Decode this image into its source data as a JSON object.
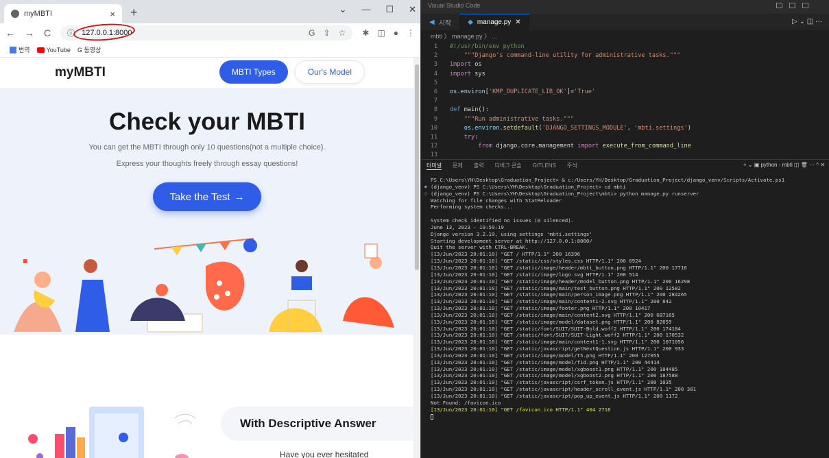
{
  "browser": {
    "tab_title": "myMBTI",
    "new_tab": "+",
    "url": "127.0.0.1:8000",
    "bookmarks": [
      "번역",
      "YouTube",
      "G 동영상"
    ],
    "window_controls": [
      "⌄",
      "—",
      "☐",
      "✕"
    ]
  },
  "site": {
    "logo": "myMBTI",
    "nav": [
      "MBTI Types",
      "Our's Model"
    ],
    "hero_title": "Check your MBTI",
    "hero_line1": "You can get the MBTI through only 10 questions(not a multiple choice).",
    "hero_line2": "Express your thoughts freely through essay questions!",
    "cta": "Take the Test",
    "cta_arrow": "→",
    "section2_title": "With Descriptive Answer",
    "section2_text": "Have you ever hesitated"
  },
  "vscode": {
    "title": "Visual Studio Code",
    "tabs": [
      "시작",
      "manage.py"
    ],
    "breadcrumb": "mbti 〉 manage.py 〉 ...",
    "code": [
      {
        "n": "1",
        "t": [
          [
            "cm",
            "#!/usr/bin/env python"
          ]
        ]
      },
      {
        "n": "2",
        "t": [
          [
            "st",
            "    \"\"\"Django's command-line utility for administrative tasks.\"\"\""
          ]
        ]
      },
      {
        "n": "3",
        "t": [
          [
            "kw",
            "import"
          ],
          [
            "df",
            " os"
          ]
        ]
      },
      {
        "n": "4",
        "t": [
          [
            "kw",
            "import"
          ],
          [
            "df",
            " sys"
          ]
        ]
      },
      {
        "n": "5",
        "t": [
          [
            "df",
            ""
          ]
        ]
      },
      {
        "n": "6",
        "t": [
          [
            "id",
            "os"
          ],
          [
            "df",
            "."
          ],
          [
            "id",
            "environ"
          ],
          [
            "df",
            "["
          ],
          [
            "st",
            "'KMP_DUPLICATE_LIB_OK'"
          ],
          [
            "df",
            "]="
          ],
          [
            "st",
            "'True'"
          ]
        ]
      },
      {
        "n": "7",
        "t": [
          [
            "df",
            ""
          ]
        ]
      },
      {
        "n": "8",
        "t": [
          [
            "kb",
            "def"
          ],
          [
            "df",
            " "
          ],
          [
            "fn",
            "main"
          ],
          [
            "df",
            "():"
          ]
        ]
      },
      {
        "n": "9",
        "t": [
          [
            "st",
            "    \"\"\"Run administrative tasks.\"\"\""
          ]
        ]
      },
      {
        "n": "10",
        "t": [
          [
            "df",
            "    "
          ],
          [
            "id",
            "os"
          ],
          [
            "df",
            "."
          ],
          [
            "id",
            "environ"
          ],
          [
            "df",
            "."
          ],
          [
            "fn",
            "setdefault"
          ],
          [
            "df",
            "("
          ],
          [
            "st",
            "'DJANGO_SETTINGS_MODULE'"
          ],
          [
            "df",
            ", "
          ],
          [
            "st",
            "'mbti.settings'"
          ],
          [
            "df",
            ")"
          ]
        ]
      },
      {
        "n": "11",
        "t": [
          [
            "df",
            "    "
          ],
          [
            "kw",
            "try"
          ],
          [
            "df",
            ":"
          ]
        ]
      },
      {
        "n": "12",
        "t": [
          [
            "df",
            "        "
          ],
          [
            "kw",
            "from"
          ],
          [
            "df",
            " django.core.management "
          ],
          [
            "kw",
            "import"
          ],
          [
            "df",
            " "
          ],
          [
            "fn",
            "execute_from_command_line"
          ]
        ]
      },
      {
        "n": "13",
        "t": [
          [
            "df",
            ""
          ]
        ]
      }
    ],
    "panel_tabs": [
      "터미널",
      "문제",
      "출력",
      "디버그 콘솔",
      "GITLENS",
      "주석"
    ],
    "panel_right": "+ ⌄  ▣ python - mbti  ◫  🗑  ···  ^  ✕",
    "terminal": [
      {
        "c": "",
        "m": "",
        "t": "PS C:\\Users\\YH\\Desktop\\Graduation_Project> & c:/Users/YH/Desktop/Graduation_Project/django_venv/Scripts/Activate.ps1"
      },
      {
        "c": "",
        "m": "●",
        "t": "(django_venv) PS C:\\Users\\YH\\Desktop\\Graduation_Project> cd mbti"
      },
      {
        "c": "",
        "m": "○",
        "t": "(django_venv) PS C:\\Users\\YH\\Desktop\\Graduation_Project\\mbti> python manage.py runserver"
      },
      {
        "c": "",
        "m": "",
        "t": "Watching for file changes with StatReloader"
      },
      {
        "c": "",
        "m": "",
        "t": "Performing system checks..."
      },
      {
        "c": "",
        "m": "",
        "t": ""
      },
      {
        "c": "",
        "m": "",
        "t": "System check identified no issues (0 silenced)."
      },
      {
        "c": "",
        "m": "",
        "t": "June 13, 2023 - 19:59:19"
      },
      {
        "c": "",
        "m": "",
        "t": "Django version 3.2.19, using settings 'mbti.settings'"
      },
      {
        "c": "",
        "m": "",
        "t": "Starting development server at http://127.0.0.1:8000/"
      },
      {
        "c": "",
        "m": "",
        "t": "Quit the server with CTRL-BREAK."
      },
      {
        "c": "",
        "m": "",
        "t": "[13/Jun/2023 20:01:10] \"GET / HTTP/1.1\" 200 16396"
      },
      {
        "c": "",
        "m": "",
        "t": "[13/Jun/2023 20:01:10] \"GET /static/css/styles.css HTTP/1.1\" 200 6924"
      },
      {
        "c": "",
        "m": "",
        "t": "[13/Jun/2023 20:01:10] \"GET /static/image/header/mbti_button.png HTTP/1.1\" 200 17716"
      },
      {
        "c": "",
        "m": "",
        "t": "[13/Jun/2023 20:01:10] \"GET /static/image/logo.svg HTTP/1.1\" 200 514"
      },
      {
        "c": "",
        "m": "",
        "t": "[13/Jun/2023 20:01:10] \"GET /static/image/header/model_button.png HTTP/1.1\" 200 16298"
      },
      {
        "c": "",
        "m": "",
        "t": "[13/Jun/2023 20:01:10] \"GET /static/image/main/test_button.png HTTP/1.1\" 200 12582"
      },
      {
        "c": "",
        "m": "",
        "t": "[13/Jun/2023 20:01:10] \"GET /static/image/main/person_image.png HTTP/1.1\" 200 284265"
      },
      {
        "c": "",
        "m": "",
        "t": "[13/Jun/2023 20:01:10] \"GET /static/image/main/content1-2.svg HTTP/1.1\" 200 842"
      },
      {
        "c": "",
        "m": "",
        "t": "[13/Jun/2023 20:01:10] \"GET /static/image/footer.png HTTP/1.1\" 200 10417"
      },
      {
        "c": "",
        "m": "",
        "t": "[13/Jun/2023 20:01:10] \"GET /static/image/main/content2.svg HTTP/1.1\" 200 687165"
      },
      {
        "c": "",
        "m": "",
        "t": "[13/Jun/2023 20:01:10] \"GET /static/image/model/dataset.png HTTP/1.1\" 200 82659"
      },
      {
        "c": "",
        "m": "",
        "t": "[13/Jun/2023 20:01:10] \"GET /static/font/SUIT/SUIT-Bold.woff2 HTTP/1.1\" 200 174184"
      },
      {
        "c": "",
        "m": "",
        "t": "[13/Jun/2023 20:01:10] \"GET /static/font/SUIT/SUIT-Light.woff2 HTTP/1.1\" 200 170532"
      },
      {
        "c": "",
        "m": "",
        "t": "[13/Jun/2023 20:01:10] \"GET /static/image/main/content1-1.svg HTTP/1.1\" 200 1071056"
      },
      {
        "c": "",
        "m": "",
        "t": "[13/Jun/2023 20:01:10] \"GET /static/javascript/getNextQuestion.js HTTP/1.1\" 200 933"
      },
      {
        "c": "",
        "m": "",
        "t": "[13/Jun/2023 20:01:10] \"GET /static/image/model/t5.png HTTP/1.1\" 200 127055"
      },
      {
        "c": "",
        "m": "",
        "t": "[13/Jun/2023 20:01:10] \"GET /static/image/model/fid.png HTTP/1.1\" 200 44414"
      },
      {
        "c": "",
        "m": "",
        "t": "[13/Jun/2023 20:01:10] \"GET /static/image/model/xgboost1.png HTTP/1.1\" 200 184485"
      },
      {
        "c": "",
        "m": "",
        "t": "[13/Jun/2023 20:01:10] \"GET /static/image/model/xgboost2.png HTTP/1.1\" 200 187588"
      },
      {
        "c": "",
        "m": "",
        "t": "[13/Jun/2023 20:01:10] \"GET /static/javascript/csrf_token.js HTTP/1.1\" 200 1035"
      },
      {
        "c": "",
        "m": "",
        "t": "[13/Jun/2023 20:01:10] \"GET /static/javascript/header_scroll_event.js HTTP/1.1\" 200 301"
      },
      {
        "c": "",
        "m": "",
        "t": "[13/Jun/2023 20:01:10] \"GET /static/javascript/pop_up_event.js HTTP/1.1\" 200 1172"
      },
      {
        "c": "",
        "m": "",
        "t": "Not Found: /favicon.ico"
      },
      {
        "c": "y",
        "m": "",
        "t": "[13/Jun/2023 20:01:10] \"GET /favicon.ico HTTP/1.1\" 404 2716"
      }
    ]
  },
  "colors": {
    "accent": "#2f5de8",
    "hero_bg": "#eef2fb",
    "editor_bg": "#1e1e1e"
  }
}
